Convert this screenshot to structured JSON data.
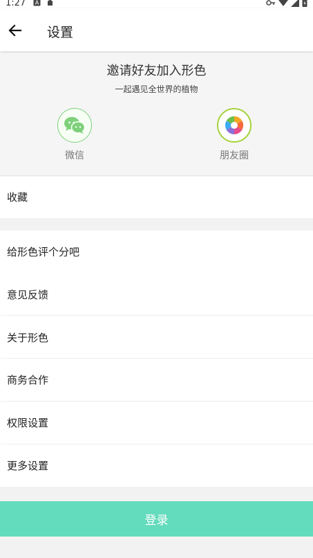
{
  "status_bar": {
    "time": "1:27"
  },
  "toolbar": {
    "title": "设置"
  },
  "invite": {
    "title": "邀请好友加入形色",
    "subtitle": "一起遇见全世界的植物",
    "share_options": [
      {
        "label": "微信",
        "icon": "wechat-icon"
      },
      {
        "label": "朋友圈",
        "icon": "moments-icon"
      }
    ]
  },
  "menu": {
    "favorites": "收藏",
    "rate": "给形色评个分吧",
    "feedback": "意见反馈",
    "about": "关于形色",
    "business": "商务合作",
    "permissions": "权限设置",
    "more": "更多设置"
  },
  "login_label": "登录",
  "colors": {
    "accent": "#63dbbd",
    "wechat_green": "#7ed07a"
  }
}
